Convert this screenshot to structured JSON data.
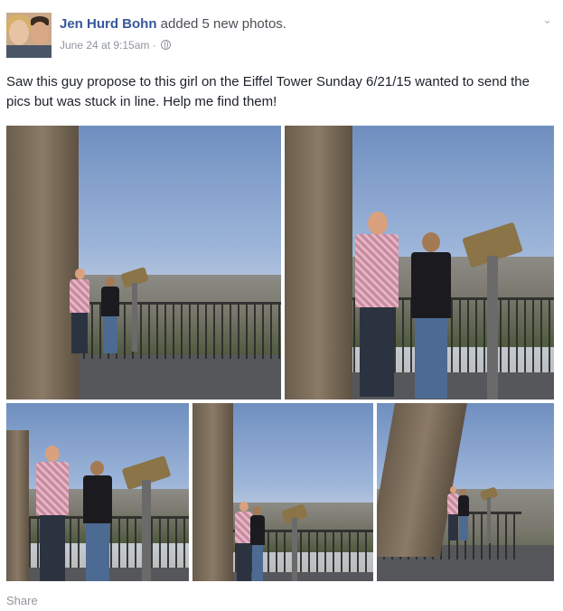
{
  "post": {
    "author": "Jen Hurd Bohn",
    "action": "added 5 new photos.",
    "timestamp": "June 24 at 9:15am",
    "separator": "·",
    "caption": "Saw this guy propose to this girl on the Eiffel Tower Sunday 6/21/15 wanted to send the pics but was stuck in line. Help me find them!",
    "share_label": "Share",
    "options_icon": "chevron-down-icon",
    "privacy_icon": "globe-icon"
  },
  "colors": {
    "author_link": "#365899",
    "meta_text": "#90949c",
    "body_text": "#1d2129"
  },
  "photos": [
    {
      "name": "photo-1",
      "description_icon": "proposal-photo"
    },
    {
      "name": "photo-2",
      "description_icon": "proposal-photo"
    },
    {
      "name": "photo-3",
      "description_icon": "proposal-photo"
    },
    {
      "name": "photo-4",
      "description_icon": "proposal-photo"
    },
    {
      "name": "photo-5",
      "description_icon": "proposal-photo"
    }
  ]
}
